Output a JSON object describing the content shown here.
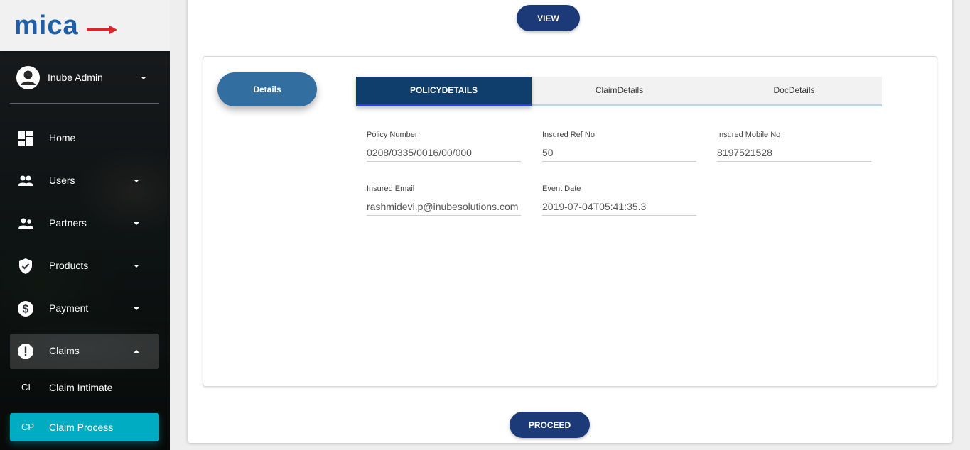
{
  "brand": {
    "logo_text": "mica"
  },
  "user": {
    "name": "Inube Admin"
  },
  "sidebar": {
    "items": [
      {
        "label": "Home",
        "icon": "dashboard-icon"
      },
      {
        "label": "Users",
        "icon": "users-icon"
      },
      {
        "label": "Partners",
        "icon": "partners-icon"
      },
      {
        "label": "Products",
        "icon": "shield-check-icon"
      },
      {
        "label": "Payment",
        "icon": "dollar-icon"
      },
      {
        "label": "Claims",
        "icon": "alert-icon"
      }
    ],
    "sub_items": [
      {
        "abbr": "CI",
        "label": "Claim Intimate"
      },
      {
        "abbr": "CP",
        "label": "Claim Process"
      }
    ]
  },
  "actions": {
    "view_label": "VIEW",
    "proceed_label": "PROCEED"
  },
  "details_label": "Details",
  "tabs": [
    "POLICYDETAILS",
    "ClaimDetails",
    "DocDetails"
  ],
  "fields": {
    "policy_number": {
      "label": "Policy Number",
      "value": "0208/0335/0016/00/000"
    },
    "insured_ref_no": {
      "label": "Insured Ref No",
      "value": "50"
    },
    "insured_mobile_no": {
      "label": "Insured Mobile No",
      "value": "8197521528"
    },
    "insured_email": {
      "label": "Insured Email",
      "value": "rashmidevi.p@inubesolutions.com"
    },
    "event_date": {
      "label": "Event Date",
      "value": "2019-07-04T05:41:35.3"
    }
  },
  "colors": {
    "primary_button": "#1d3a78",
    "details_pill": "#336ea0",
    "active_tab": "#0f3e6c",
    "selected_nav": "#00acc1",
    "logo_blue": "#1e5fa8",
    "logo_red": "#d9262b"
  }
}
